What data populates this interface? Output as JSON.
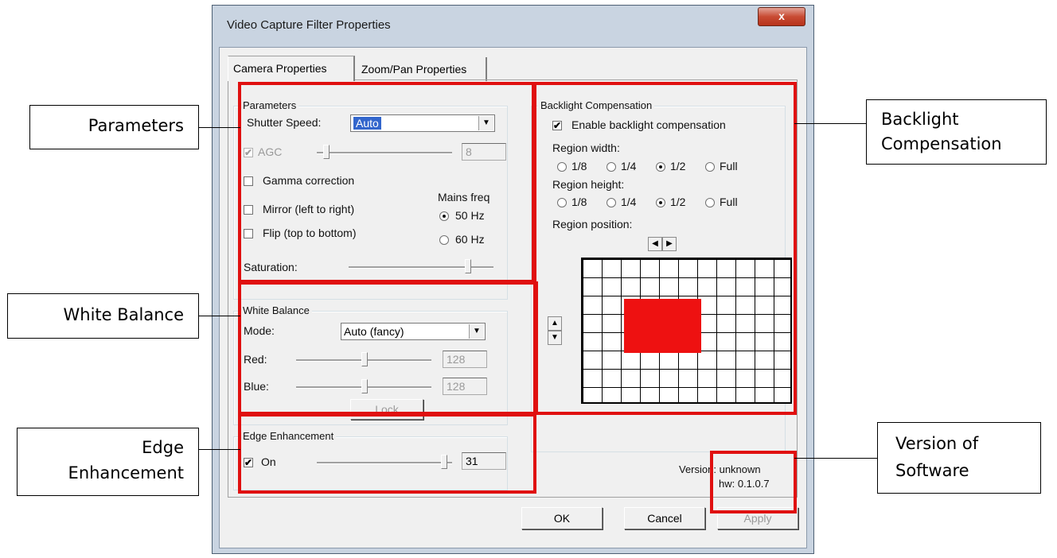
{
  "window": {
    "title": "Video Capture Filter Properties",
    "close_label": "x"
  },
  "tabs": [
    {
      "label": "Camera Properties"
    },
    {
      "label": "Zoom/Pan Properties"
    }
  ],
  "parameters": {
    "legend": "Parameters",
    "shutter_label": "Shutter Speed:",
    "shutter_value": "Auto",
    "agc_label": "AGC",
    "agc_value": "8",
    "gamma_label": "Gamma correction",
    "mirror_label": "Mirror (left to right)",
    "flip_label": "Flip (top to bottom)",
    "mains_label": "Mains freq",
    "mains_50": "50 Hz",
    "mains_60": "60 Hz",
    "saturation_label": "Saturation:"
  },
  "white_balance": {
    "legend": "White Balance",
    "mode_label": "Mode:",
    "mode_value": "Auto (fancy)",
    "red_label": "Red:",
    "red_value": "128",
    "blue_label": "Blue:",
    "blue_value": "128",
    "lock_label": "Lock"
  },
  "edge": {
    "legend": "Edge Enhancement",
    "on_label": "On",
    "value": "31"
  },
  "backlight": {
    "legend": "Backlight Compensation",
    "enable_label": "Enable backlight compensation",
    "width_label": "Region width:",
    "height_label": "Region height:",
    "position_label": "Region position:",
    "options": [
      "1/8",
      "1/4",
      "1/2",
      "Full"
    ],
    "selected_width": "1/2",
    "selected_height": "1/2"
  },
  "version": {
    "line1": "Version: unknown",
    "line2": "hw: 0.1.0.7"
  },
  "buttons": {
    "ok": "OK",
    "cancel": "Cancel",
    "apply": "Apply"
  },
  "callouts": {
    "parameters": "Parameters",
    "white_balance": "White Balance",
    "edge_line1": "Edge",
    "edge_line2": "Enhancement",
    "backlight_line1": "Backlight",
    "backlight_line2": "Compensation",
    "version_line1": "Version of",
    "version_line2": "Software"
  },
  "colors": {
    "highlight_box": "#e01010",
    "region_fill": "#ee1111"
  },
  "icons": {
    "check": "✔",
    "combo_arrow": "▼",
    "left": "◀",
    "right": "▶",
    "up": "▲",
    "down": "▼"
  }
}
